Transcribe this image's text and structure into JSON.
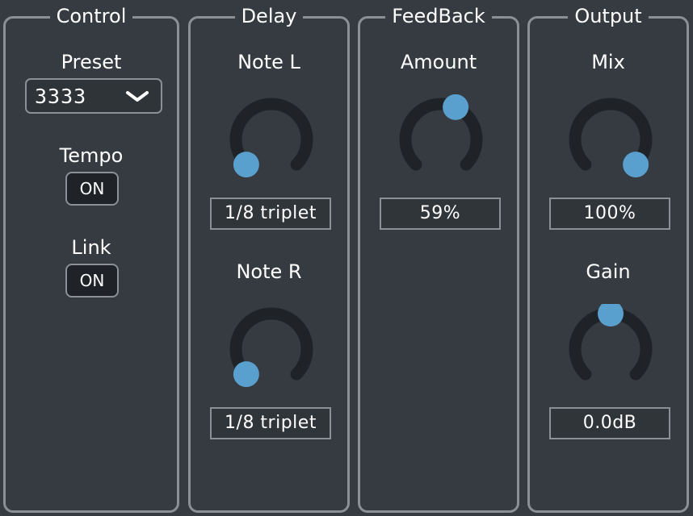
{
  "panels": {
    "control": {
      "title": "Control",
      "preset_label": "Preset",
      "preset_value": "3333",
      "tempo_label": "Tempo",
      "tempo_value": "ON",
      "link_label": "Link",
      "link_value": "ON"
    },
    "delay": {
      "title": "Delay",
      "note_l_label": "Note L",
      "note_l_value": "1/8 triplet",
      "note_l_knob_fraction": 0.0,
      "note_r_label": "Note R",
      "note_r_value": "1/8 triplet",
      "note_r_knob_fraction": 0.0
    },
    "feedback": {
      "title": "FeedBack",
      "amount_label": "Amount",
      "amount_value": "59%",
      "amount_knob_fraction": 0.59
    },
    "output": {
      "title": "Output",
      "mix_label": "Mix",
      "mix_value": "100%",
      "mix_knob_fraction": 1.0,
      "gain_label": "Gain",
      "gain_value": "0.0dB",
      "gain_knob_fraction": 0.5
    }
  },
  "icons": {
    "preset_dropdown": "chevron-down-icon"
  },
  "colors": {
    "background": "#353b41",
    "border": "#8a9096",
    "knob_track": "#1f2327",
    "knob_handle": "#5aa0cf"
  }
}
